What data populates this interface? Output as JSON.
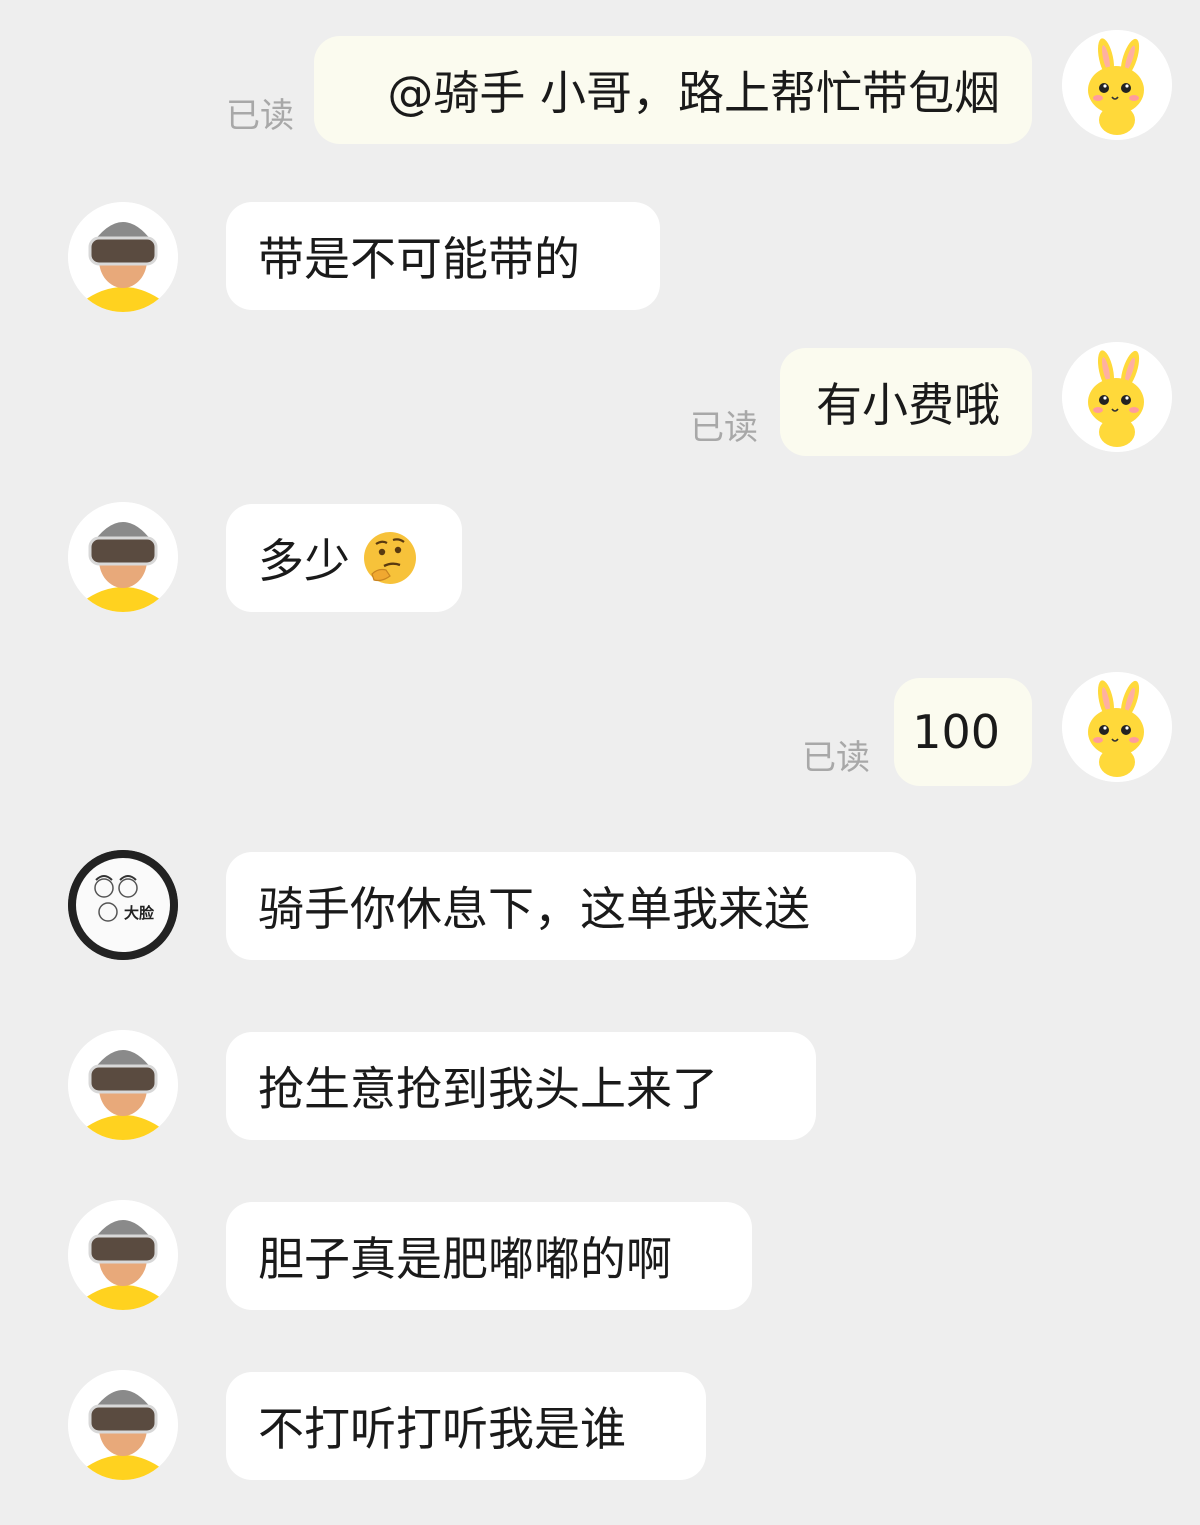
{
  "chat": {
    "read_label": "已读",
    "messages": [
      {
        "sender": "self",
        "avatar": "bunny-avatar",
        "text": "@骑手 小哥，路上帮忙带包烟",
        "read": true
      },
      {
        "sender": "rider",
        "avatar": "rider-avatar",
        "text": "带是不可能带的"
      },
      {
        "sender": "self",
        "avatar": "bunny-avatar",
        "text": "有小费哦",
        "read": true
      },
      {
        "sender": "rider",
        "avatar": "rider-avatar",
        "text": "多少",
        "emoji": "thinking-face-icon"
      },
      {
        "sender": "self",
        "avatar": "bunny-avatar",
        "text": "100",
        "read": true
      },
      {
        "sender": "other",
        "avatar": "daillan-logo-avatar",
        "avatar_text": "大脸",
        "text": "骑手你休息下，这单我来送"
      },
      {
        "sender": "rider",
        "avatar": "rider-avatar",
        "text": "抢生意抢到我头上来了"
      },
      {
        "sender": "rider",
        "avatar": "rider-avatar",
        "text": "胆子真是肥嘟嘟的啊"
      },
      {
        "sender": "rider",
        "avatar": "rider-avatar",
        "text": "不打听打听我是谁"
      }
    ]
  },
  "colors": {
    "background": "#eeeeee",
    "outgoing_bubble": "#fbfbef",
    "incoming_bubble": "#ffffff",
    "read_text": "#a8a8a8",
    "rider_shirt": "#ffd21f",
    "bunny": "#ffd93a"
  }
}
